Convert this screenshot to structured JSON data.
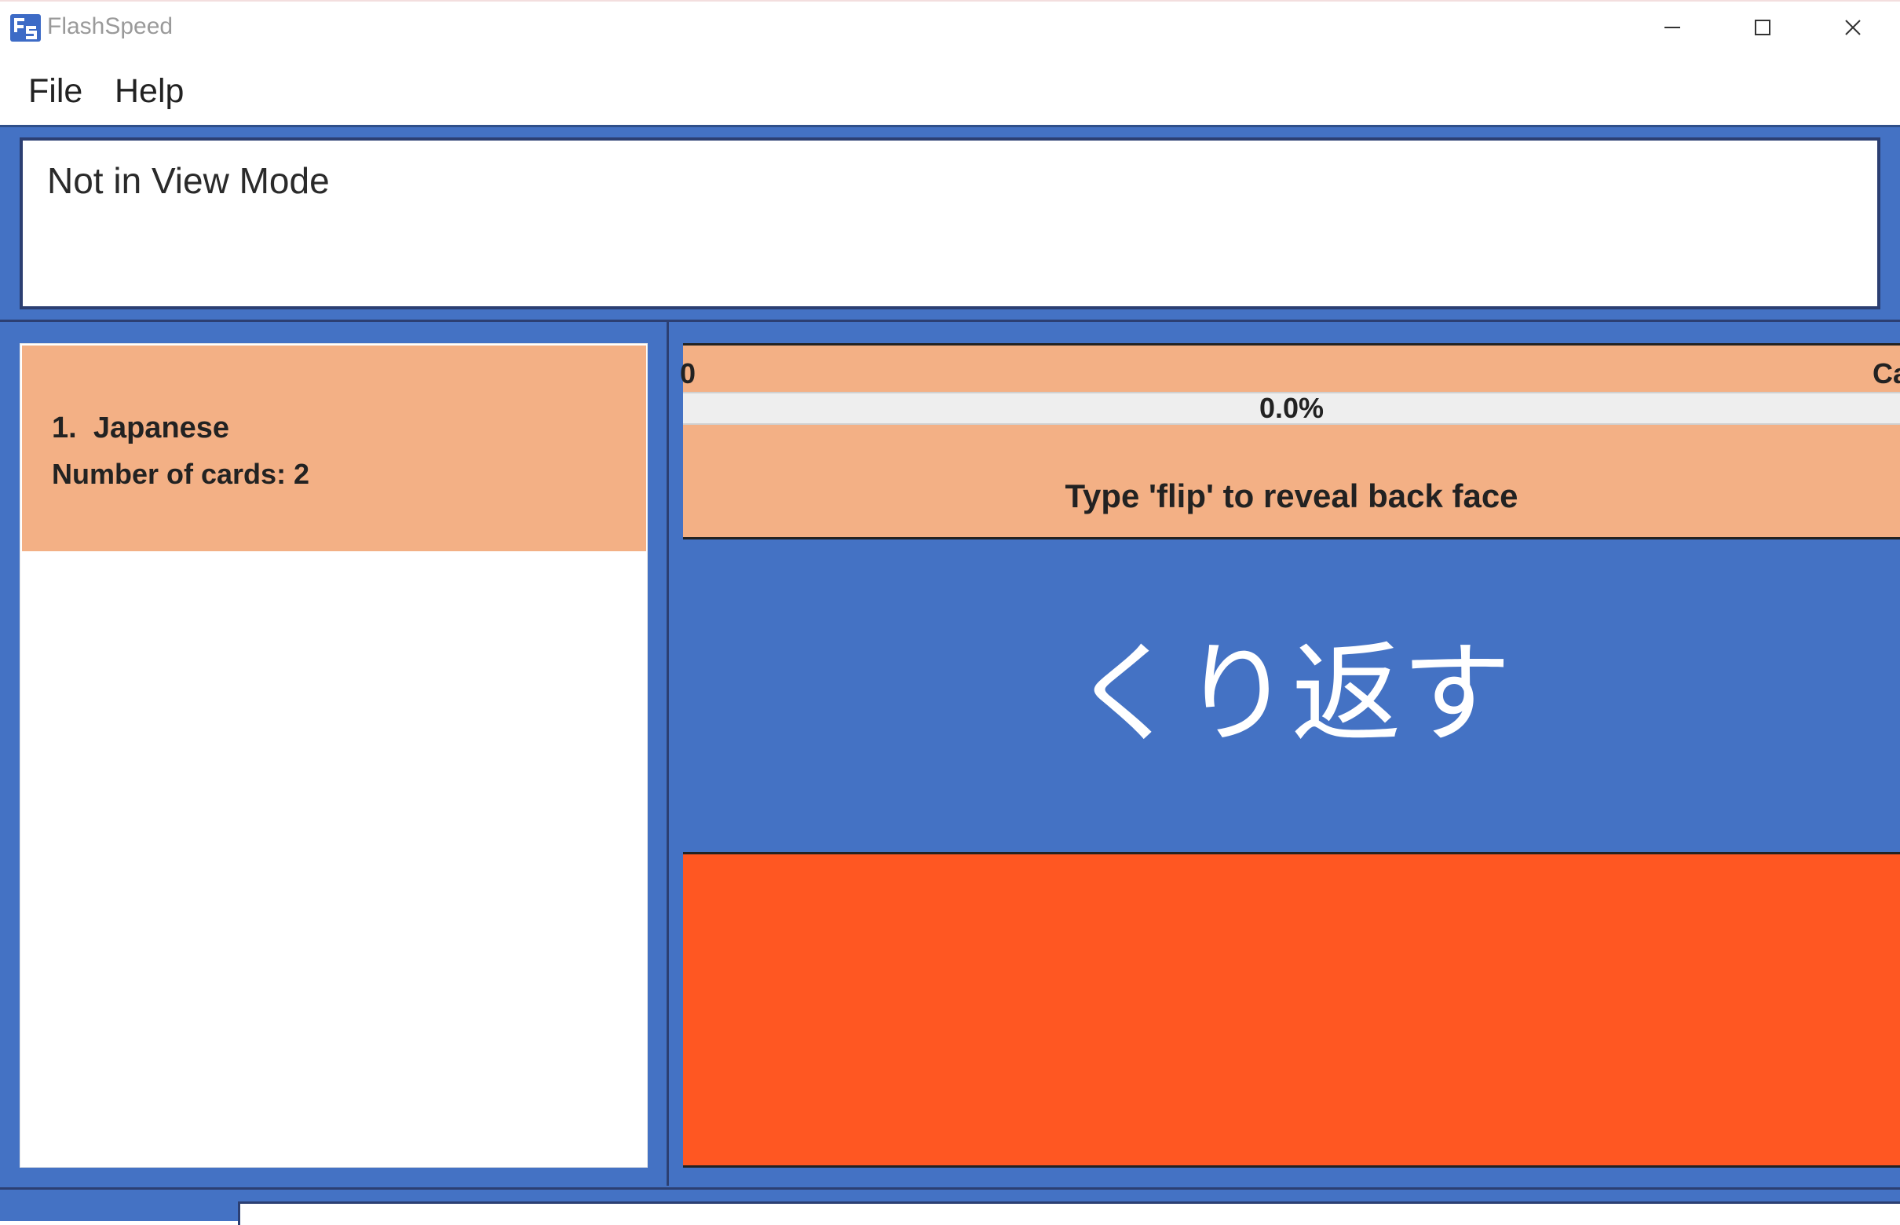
{
  "app": {
    "title": "FlashSpeed",
    "icon": "app-logo-icon",
    "window_controls": [
      "minimize-icon",
      "maximize-icon",
      "close-icon"
    ]
  },
  "menu": {
    "file": "File",
    "help": "Help"
  },
  "result_display": {
    "text": "Not in View Mode"
  },
  "deck_list": {
    "decks": [
      {
        "index": "1.",
        "name": "Japanese",
        "count_label": "Number of cards: 2"
      }
    ]
  },
  "card_panel": {
    "stat_left": "0",
    "stat_right": "Ca",
    "progress": {
      "value": 0.0,
      "label": "0.0%"
    },
    "hint": "Type 'flip' to reveal back face",
    "front_text": "くり返す",
    "back_text": ""
  },
  "command_box": {
    "value": ""
  },
  "colors": {
    "primary_blue": "#4472c4",
    "dark_border": "#2c3f72",
    "peach": "#f3b085",
    "back_face_orange": "#ff5722"
  }
}
